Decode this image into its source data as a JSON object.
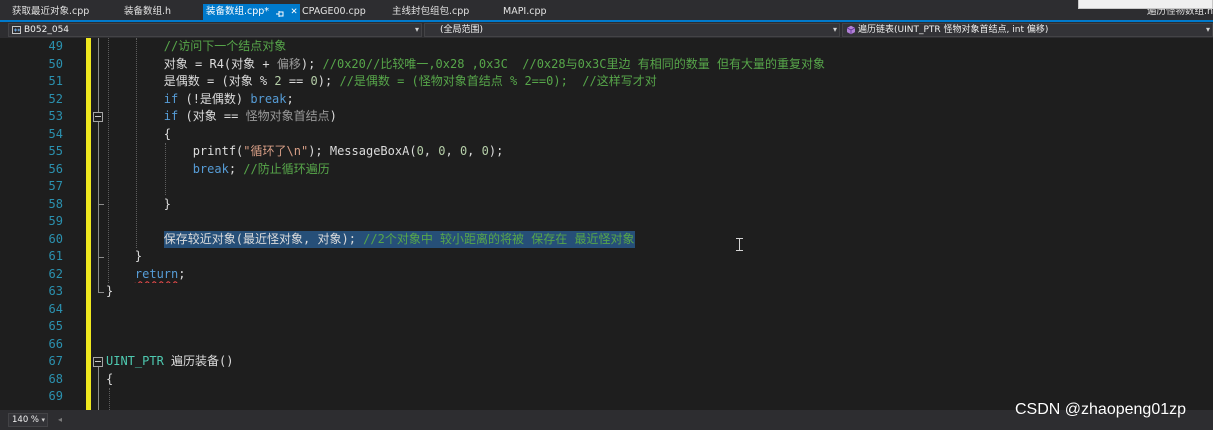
{
  "tabs": [
    {
      "label": "获取最近对象.cpp",
      "active": false
    },
    {
      "label": "装备数组.h",
      "active": false
    },
    {
      "label": "装备数组.cpp*",
      "active": true,
      "pin_icon": "pin-icon",
      "close_icon": "close-icon",
      "close_glyph": "✕"
    },
    {
      "label": "CPAGE00.cpp",
      "active": false
    },
    {
      "label": "主线封包组包.cpp",
      "active": false
    },
    {
      "label": "MAPI.cpp",
      "active": false
    }
  ],
  "overflow_tab": {
    "label": "遍历怪物数组.h"
  },
  "nav": {
    "project": {
      "icon": "cpp-project-icon",
      "label": "B052_054"
    },
    "scope": {
      "label": "(全局范围)"
    },
    "member": {
      "icon": "method-icon",
      "label": "遍历链表(UINT_PTR 怪物对象首结点, int 偏移)"
    },
    "dropdown_glyph": "▾"
  },
  "editor": {
    "lines": [
      {
        "num": "49",
        "tokens": [
          {
            "t": "        ",
            "k": "ws"
          },
          {
            "t": "//访问下一个结点对象",
            "k": "comment"
          }
        ]
      },
      {
        "num": "50",
        "tokens": [
          {
            "t": "        ",
            "k": "ws"
          },
          {
            "t": "对象 = R4(对象 + ",
            "k": "text"
          },
          {
            "t": "偏移",
            "k": "param"
          },
          {
            "t": "); ",
            "k": "text"
          },
          {
            "t": "//0x20//比较唯一,0x28 ,0x3C  //0x28与0x3C里边 有相同的数量 但有大量的重复对象",
            "k": "comment"
          }
        ]
      },
      {
        "num": "51",
        "tokens": [
          {
            "t": "        ",
            "k": "ws"
          },
          {
            "t": "是偶数 = (对象 % ",
            "k": "text"
          },
          {
            "t": "2",
            "k": "number"
          },
          {
            "t": " == ",
            "k": "text"
          },
          {
            "t": "0",
            "k": "number"
          },
          {
            "t": "); ",
            "k": "text"
          },
          {
            "t": "//是偶数 = (怪物对象首结点 % 2==0);  //这样写才对",
            "k": "comment"
          }
        ]
      },
      {
        "num": "52",
        "tokens": [
          {
            "t": "        ",
            "k": "ws"
          },
          {
            "t": "if",
            "k": "keyword"
          },
          {
            "t": " (!是偶数) ",
            "k": "text"
          },
          {
            "t": "break",
            "k": "keyword"
          },
          {
            "t": ";",
            "k": "text"
          }
        ]
      },
      {
        "num": "53",
        "tokens": [
          {
            "t": "        ",
            "k": "ws"
          },
          {
            "t": "if",
            "k": "keyword"
          },
          {
            "t": " (对象 == ",
            "k": "text"
          },
          {
            "t": "怪物对象首结点",
            "k": "param"
          },
          {
            "t": ")",
            "k": "text"
          }
        ]
      },
      {
        "num": "54",
        "tokens": [
          {
            "t": "        ",
            "k": "ws"
          },
          {
            "t": "{",
            "k": "text"
          }
        ]
      },
      {
        "num": "55",
        "tokens": [
          {
            "t": "            ",
            "k": "ws"
          },
          {
            "t": "printf(",
            "k": "text"
          },
          {
            "t": "\"循环了\\n\"",
            "k": "string"
          },
          {
            "t": "); MessageBoxA(",
            "k": "text"
          },
          {
            "t": "0",
            "k": "number"
          },
          {
            "t": ", ",
            "k": "text"
          },
          {
            "t": "0",
            "k": "number"
          },
          {
            "t": ", ",
            "k": "text"
          },
          {
            "t": "0",
            "k": "number"
          },
          {
            "t": ", ",
            "k": "text"
          },
          {
            "t": "0",
            "k": "number"
          },
          {
            "t": ");",
            "k": "text"
          }
        ]
      },
      {
        "num": "56",
        "tokens": [
          {
            "t": "            ",
            "k": "ws"
          },
          {
            "t": "break",
            "k": "keyword"
          },
          {
            "t": "; ",
            "k": "text"
          },
          {
            "t": "//防止循环遍历",
            "k": "comment"
          }
        ]
      },
      {
        "num": "57",
        "tokens": []
      },
      {
        "num": "58",
        "tokens": [
          {
            "t": "        ",
            "k": "ws"
          },
          {
            "t": "}",
            "k": "text"
          }
        ]
      },
      {
        "num": "59",
        "tokens": []
      },
      {
        "num": "60",
        "tokens": [
          {
            "t": "        ",
            "k": "ws"
          },
          {
            "t": "保存较近对象(最近怪对象, 对象); ",
            "k": "text",
            "selected": true
          },
          {
            "t": "//2个对象中 较小距离的将被 保存在 最近怪对象",
            "k": "comment",
            "selected": true
          }
        ]
      },
      {
        "num": "61",
        "tokens": [
          {
            "t": "    ",
            "k": "ws"
          },
          {
            "t": "}",
            "k": "text"
          }
        ]
      },
      {
        "num": "62",
        "tokens": [
          {
            "t": "    ",
            "k": "ws"
          },
          {
            "t": "return",
            "k": "keyword",
            "error": true
          },
          {
            "t": ";",
            "k": "text"
          }
        ]
      },
      {
        "num": "63",
        "tokens": [
          {
            "t": "}",
            "k": "text"
          }
        ]
      },
      {
        "num": "64",
        "tokens": []
      },
      {
        "num": "65",
        "tokens": []
      },
      {
        "num": "66",
        "tokens": []
      },
      {
        "num": "67",
        "tokens": [
          {
            "t": "UINT_PTR",
            "k": "type"
          },
          {
            "t": " 遍历装备()",
            "k": "text"
          }
        ]
      },
      {
        "num": "68",
        "tokens": [
          {
            "t": "{",
            "k": "text"
          }
        ]
      },
      {
        "num": "69",
        "tokens": []
      }
    ]
  },
  "status": {
    "zoom": "140 %",
    "zoom_glyph": "▾",
    "scroll_left_glyph": "◂"
  },
  "watermark": "CSDN @zhaopeng01zp",
  "colors": {
    "editor_background": "#1E1E1E",
    "accent": "#007ACC",
    "line_number": "#2B91AF",
    "change_bar": "#EFE81F",
    "selection": "#264F78",
    "text": "#DCDCDC",
    "comment": "#57A64A",
    "keyword": "#569CD6",
    "string": "#D69D85",
    "number": "#B5CEA8",
    "type": "#4EC9B0",
    "param": "#9A9A9A",
    "error_squiggle": "#F14C4C"
  }
}
